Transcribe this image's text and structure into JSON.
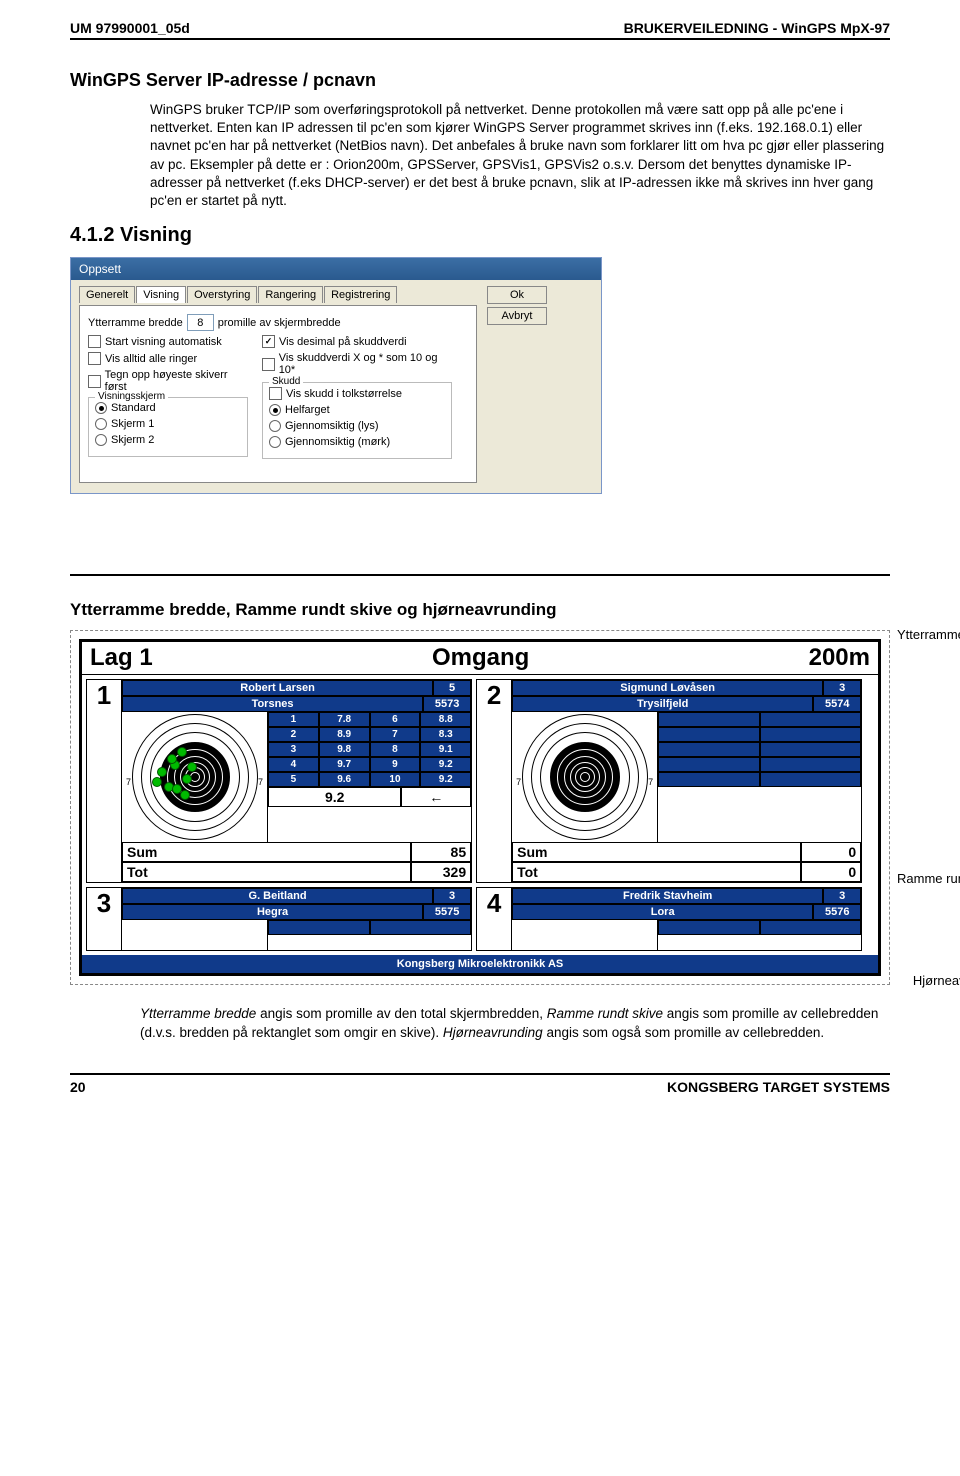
{
  "header_left": "UM 97990001_05d",
  "header_right": "BRUKERVEILEDNING - WinGPS MpX-97",
  "h2": "WinGPS Server IP-adresse / pcnavn",
  "para": "WinGPS bruker TCP/IP som overføringsprotokoll på nettverket. Denne protokollen må være satt opp på alle pc'ene i nettverket. Enten kan IP adressen til pc'en som kjører WinGPS Server programmet skrives inn (f.eks. 192.168.0.1) eller navnet pc'en har på nettverket (NetBios navn). Det anbefales å bruke navn som forklarer litt om hva pc gjør eller plassering av pc. Eksempler på dette er : Orion200m, GPSServer, GPSVis1, GPSVis2 o.s.v. Dersom det benyttes dynamiske IP-adresser på nettverket (f.eks DHCP-server) er det best å bruke pcnavn, slik at IP-adressen ikke må skrives inn hver gang pc'en er startet på nytt.",
  "h3": "4.1.2 Visning",
  "dialog": {
    "title": "Oppsett",
    "tabs": [
      "Generelt",
      "Visning",
      "Overstyring",
      "Rangering",
      "Registrering"
    ],
    "ytter_label": "Ytterramme bredde",
    "ytter_val": "8",
    "ytter_suffix": "promille av skjermbredde",
    "left_checks": [
      "Start visning automatisk",
      "Vis alltid alle ringer",
      "Tegn opp høyeste skiverr først"
    ],
    "right_checks": [
      "Vis desimal på skuddverdi",
      "Vis skuddverdi X og * som 10 og 10*"
    ],
    "grp_visn": "Visningsskjerm",
    "visn_opts": [
      "Standard",
      "Skjerm 1",
      "Skjerm 2"
    ],
    "grp_skudd": "Skudd",
    "skudd_cb": "Vis skudd i tolkstørrelse",
    "skudd_opts": [
      "Helfarget",
      "Gjennomsiktig (lys)",
      "Gjennomsiktig (mørk)"
    ],
    "ok": "Ok",
    "cancel": "Avbryt"
  },
  "sec": "Ytterramme bredde, Ramme rundt skive og hjørneavrunding",
  "callout1": "Ytterramme bredde",
  "callout2": "Ramme rundt skive",
  "callout3": "Hjørneavrunding",
  "score": {
    "h1": "Lag 1",
    "h2": "Omgang",
    "h3": "200m",
    "cells": [
      {
        "lane": "1",
        "name": "Robert Larsen",
        "club": "Torsnes",
        "hits": "5",
        "tot": "5573",
        "rows": [
          [
            "1",
            "7.8",
            "6",
            "8.8"
          ],
          [
            "2",
            "8.9",
            "7",
            "8.3"
          ],
          [
            "3",
            "9.8",
            "8",
            "9.1"
          ],
          [
            "4",
            "9.7",
            "9",
            "9.2"
          ],
          [
            "5",
            "9.6",
            "10",
            "9.2"
          ]
        ],
        "big": "9.2",
        "arrow": "←",
        "sum": "85",
        "tot2": "329",
        "dots": true
      },
      {
        "lane": "2",
        "name": "Sigmund Løvåsen",
        "club": "Trysilfjeld",
        "hits": "3",
        "tot": "5574",
        "rows": [],
        "sum": "0",
        "tot2": "0",
        "dots": false
      },
      {
        "lane": "3",
        "name": "G. Beitland",
        "club": "Hegra",
        "hits": "3",
        "tot": "5575",
        "rows": [],
        "sum": "0",
        "tot2": "0",
        "dots": false,
        "partial": true
      },
      {
        "lane": "4",
        "name": "Fredrik Stavheim",
        "club": "Lora",
        "hits": "3",
        "tot": "5576",
        "rows": [],
        "sum": "0",
        "tot2": "0",
        "dots": false,
        "partial": true
      }
    ],
    "footer": "Kongsberg Mikroelektronikk AS",
    "sum_lbl": "Sum",
    "tot_lbl": "Tot"
  },
  "body2": "Ytterramme bredde angis som promille av den total skjermbredden, Ramme rundt skive angis som promille av cellebredden (d.v.s. bredden på rektanglet som omgir en skive). Hjørneavrunding angis som også som promille av cellebredden.",
  "footer_left": "20",
  "footer_right": "KONGSBERG TARGET SYSTEMS"
}
